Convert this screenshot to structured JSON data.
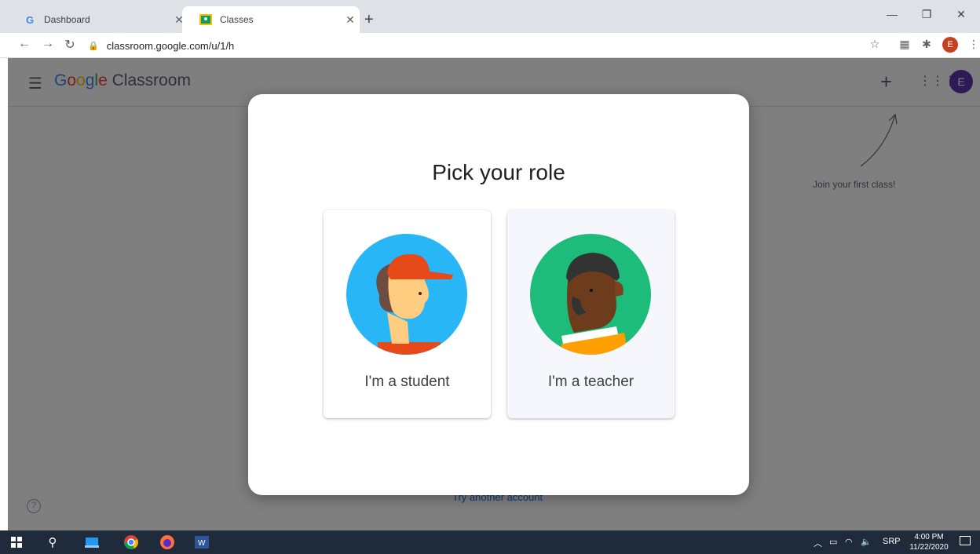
{
  "browser": {
    "tabs": [
      {
        "title": "Dashboard",
        "favicon": "google-g-icon"
      },
      {
        "title": "Classes",
        "favicon": "classroom-icon"
      }
    ],
    "url": "classroom.google.com/u/1/h",
    "profile_initial": "E"
  },
  "app": {
    "logo_google": [
      "G",
      "o",
      "o",
      "g",
      "l",
      "e"
    ],
    "logo_product": "Classroom",
    "avatar_initial": "E",
    "join_hint": "Join your first class!",
    "try_link": "Try another account"
  },
  "dialog": {
    "title": "Pick your role",
    "student_label": "I'm a student",
    "teacher_label": "I'm a teacher"
  },
  "taskbar": {
    "language": "SRP",
    "time": "4:00 PM",
    "date": "11/22/2020"
  },
  "colors": {
    "student_bg": "#29b6f6",
    "teacher_bg": "#1ebc7a",
    "avatar": "#5e35b1"
  }
}
